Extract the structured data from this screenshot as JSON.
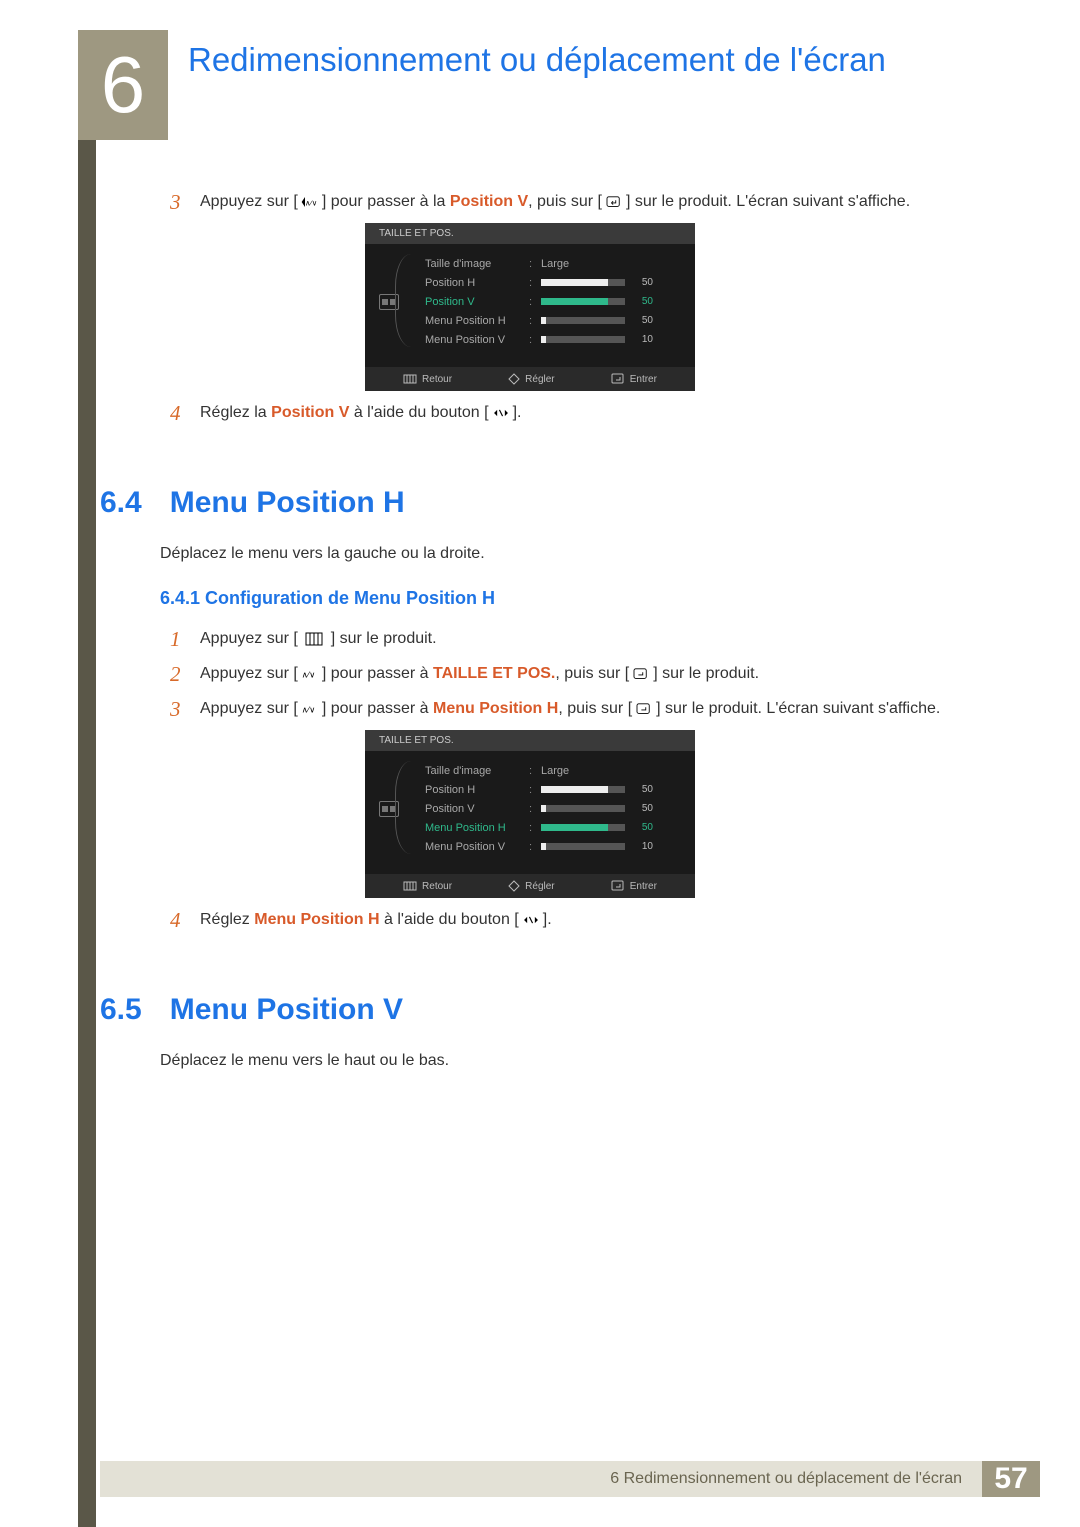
{
  "chapter": {
    "number": "6",
    "title": "Redimensionnement ou déplacement de l'écran"
  },
  "step3": {
    "num": "3",
    "t1": "Appuyez sur [",
    "t2": "] pour passer à la ",
    "hl": "Position V",
    "t3": ", puis sur [",
    "t4": "] sur le produit. L'écran suivant s'affiche."
  },
  "osd1": {
    "title": "TAILLE ET POS.",
    "rows": [
      {
        "label": "Taille d'image",
        "val": "Large",
        "bar": null,
        "sel": false
      },
      {
        "label": "Position H",
        "val": "50",
        "bar": 80,
        "sel": false
      },
      {
        "label": "Position V",
        "val": "50",
        "bar": 80,
        "sel": true
      },
      {
        "label": "Menu Position H",
        "val": "50",
        "bar": 6,
        "sel": false
      },
      {
        "label": "Menu Position V",
        "val": "10",
        "bar": 6,
        "sel": false
      }
    ],
    "footer": {
      "back": "Retour",
      "adjust": "Régler",
      "enter": "Entrer"
    }
  },
  "step4a": {
    "num": "4",
    "t1": "Réglez la ",
    "hl": "Position V",
    "t2": " à l'aide du bouton [",
    "t3": "]."
  },
  "sec64": {
    "num": "6.4",
    "title": "Menu Position H"
  },
  "sec64_desc": "Déplacez le menu vers la gauche ou la droite.",
  "sec641": {
    "text": "6.4.1  Configuration de Menu Position H"
  },
  "bstep1": {
    "num": "1",
    "t1": "Appuyez sur [ ",
    "t2": " ] sur le produit."
  },
  "bstep2": {
    "num": "2",
    "t1": "Appuyez sur [",
    "t2": "] pour passer à ",
    "hl": "TAILLE ET POS.",
    "t3": ", puis sur [",
    "t4": "] sur le produit."
  },
  "bstep3": {
    "num": "3",
    "t1": "Appuyez sur [",
    "t2": "] pour passer à ",
    "hl": "Menu Position H",
    "t3": ", puis sur [",
    "t4": "] sur le produit. L'écran suivant s'affiche."
  },
  "osd2": {
    "title": "TAILLE ET POS.",
    "rows": [
      {
        "label": "Taille d'image",
        "val": "Large",
        "bar": null,
        "sel": false
      },
      {
        "label": "Position H",
        "val": "50",
        "bar": 80,
        "sel": false
      },
      {
        "label": "Position V",
        "val": "50",
        "bar": 6,
        "sel": false
      },
      {
        "label": "Menu Position H",
        "val": "50",
        "bar": 80,
        "sel": true
      },
      {
        "label": "Menu Position V",
        "val": "10",
        "bar": 6,
        "sel": false
      }
    ],
    "footer": {
      "back": "Retour",
      "adjust": "Régler",
      "enter": "Entrer"
    }
  },
  "step4b": {
    "num": "4",
    "t1": "Réglez ",
    "hl": "Menu Position H",
    "t2": " à l'aide du bouton [",
    "t3": "]."
  },
  "sec65": {
    "num": "6.5",
    "title": "Menu Position V"
  },
  "sec65_desc": "Déplacez le menu vers le haut ou le bas.",
  "footer": {
    "text": "6 Redimensionnement ou déplacement de l'écran",
    "page": "57"
  }
}
